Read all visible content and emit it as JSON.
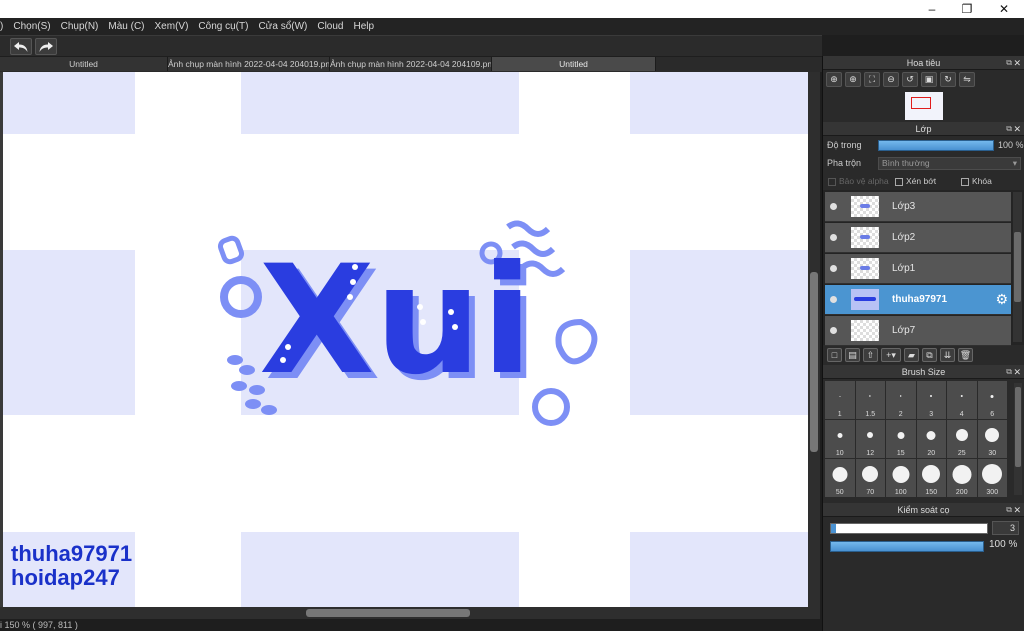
{
  "window": {
    "controls": {
      "minimize": "–",
      "maximize": "❐",
      "close": "✕"
    }
  },
  "menu": [
    {
      "label": ")"
    },
    {
      "label": "Chọn(S)"
    },
    {
      "label": "Chụp(N)"
    },
    {
      "label": "Màu (C)"
    },
    {
      "label": "Xem(V)"
    },
    {
      "label": "Công cụ(T)"
    },
    {
      "label": "Cửa sổ(W)"
    },
    {
      "label": "Cloud"
    },
    {
      "label": "Help"
    }
  ],
  "toolbar": {
    "undo_icon": "undo-arrow-icon",
    "redo_icon": "redo-arrow-icon"
  },
  "tabs": [
    {
      "label": "Untitled",
      "active": false
    },
    {
      "label": "Ảnh chụp màn hình 2022-04-04 204019.png",
      "active": false
    },
    {
      "label": "Ảnh chụp màn hình 2022-04-04 204109.png",
      "active": false
    },
    {
      "label": "Untitled",
      "active": true
    }
  ],
  "canvas": {
    "artwork_text": "Xui",
    "watermark": [
      "thuha97971",
      "hoidap247"
    ],
    "colors": {
      "primary": "#2a3de0",
      "light": "#7d8ff5",
      "bg_block": "#e3e6fb"
    }
  },
  "status": {
    "text": "i 150 %   ( 997, 811 )"
  },
  "navigator": {
    "title": "Hoa tiêu",
    "buttons": [
      "zoom-in",
      "zoom-in-2",
      "fit",
      "zoom-out",
      "rotate-left",
      "actual-size",
      "rotate-right",
      "flip"
    ]
  },
  "layers_panel": {
    "title": "Lớp",
    "opacity_label": "Độ trong",
    "opacity_value": "100 %",
    "opacity": 1.0,
    "blend_label": "Pha trộn",
    "blend_value": "Bình thường",
    "protect_alpha": "Bảo vệ alpha",
    "clipping": "Xén bớt",
    "lock": "Khóa",
    "layers": [
      {
        "name": "Lớp3",
        "selected": false
      },
      {
        "name": "Lớp2",
        "selected": false
      },
      {
        "name": "Lớp1",
        "selected": false
      },
      {
        "name": "thuha97971",
        "selected": true
      },
      {
        "name": "Lớp7",
        "selected": false
      }
    ]
  },
  "brush_size": {
    "title": "Brush Size",
    "sizes": [
      "1",
      "1.5",
      "2",
      "3",
      "4",
      "6",
      "10",
      "12",
      "15",
      "20",
      "25",
      "30",
      "50",
      "70",
      "100",
      "150",
      "200",
      "300"
    ]
  },
  "brush_control": {
    "title": "Kiểm soát cọ",
    "size_value": "3",
    "size_fraction": 0.03,
    "opacity_value": "100 %",
    "opacity": 1.0
  }
}
